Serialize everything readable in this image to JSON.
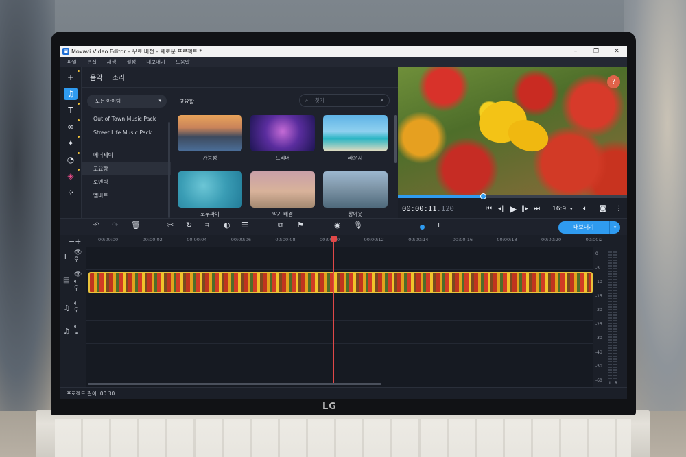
{
  "window": {
    "title": "Movavi Video Editor – 무료 버전 – 새로운 프로젝트 *",
    "minimize": "–",
    "maximize": "❐",
    "close": "✕"
  },
  "menu": [
    "파일",
    "편집",
    "재생",
    "설정",
    "내보내기",
    "도움말"
  ],
  "panel": {
    "tabs": [
      "음악",
      "소리"
    ],
    "category_dropdown": "모든 아이템",
    "categories_top": [
      "Out of Town Music Pack",
      "Street Life Music Pack"
    ],
    "categories": [
      "에너제틱",
      "고요함",
      "로맨틱",
      "엠비트"
    ],
    "selected_category": "고요함",
    "content_title": "고요함",
    "search_placeholder": "찾기",
    "items": [
      {
        "label": "가능성"
      },
      {
        "label": "드리머"
      },
      {
        "label": "라운지"
      },
      {
        "label": "로우파이"
      },
      {
        "label": "악기 배경"
      },
      {
        "label": "창야웃"
      }
    ]
  },
  "preview": {
    "help_label": "?",
    "timecode_main": "00:00:11",
    "timecode_ms": ".120",
    "aspect_ratio": "16:9",
    "progress": 0.37
  },
  "timeline": {
    "export_label": "내보내기",
    "ruler_ticks": [
      "00:00:00",
      "00:00:02",
      "00:00:04",
      "00:00:06",
      "00:00:08",
      "00:00:10",
      "00:00:12",
      "00:00:14",
      "00:00:16",
      "00:00:18",
      "00:00:20",
      "00:00:2"
    ],
    "meter_labels": [
      "0",
      "-5",
      "-10",
      "-15",
      "-20",
      "-25",
      "-30",
      "-40",
      "-50",
      "-60"
    ],
    "meter_channels": [
      "L",
      "R"
    ]
  },
  "status": {
    "project_length": "프로젝트 길이: 00:30"
  },
  "laptop_brand": "LG",
  "colors": {
    "accent": "#2f9bf0",
    "playhead": "#e04848",
    "clip_border": "#e9c23b"
  }
}
